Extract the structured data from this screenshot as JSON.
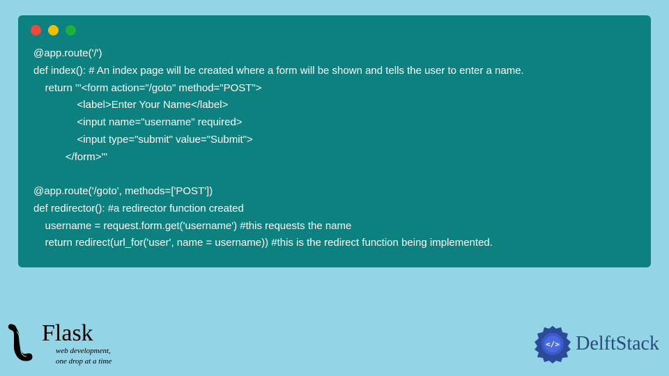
{
  "code": {
    "line1": "@app.route('/')",
    "line2": "def index(): # An index page will be created where a form will be shown and tells the user to enter a name.",
    "line3": "    return '''<form action=\"/goto\" method=\"POST\">",
    "line4": "               <label>Enter Your Name</label>",
    "line5": "               <input name=\"username\" required>",
    "line6": "               <input type=\"submit\" value=\"Submit\">",
    "line7": "           </form>'''",
    "line8": "",
    "line9": "@app.route('/goto', methods=['POST'])",
    "line10": "def redirector(): #a redirector function created",
    "line11": "    username = request.form.get('username') #this requests the name",
    "line12": "    return redirect(url_for('user', name = username)) #this is the redirect function being implemented."
  },
  "flask": {
    "title": "Flask",
    "sub1": "web development,",
    "sub2": "one drop at a time"
  },
  "delft": {
    "text": "DelftStack"
  }
}
